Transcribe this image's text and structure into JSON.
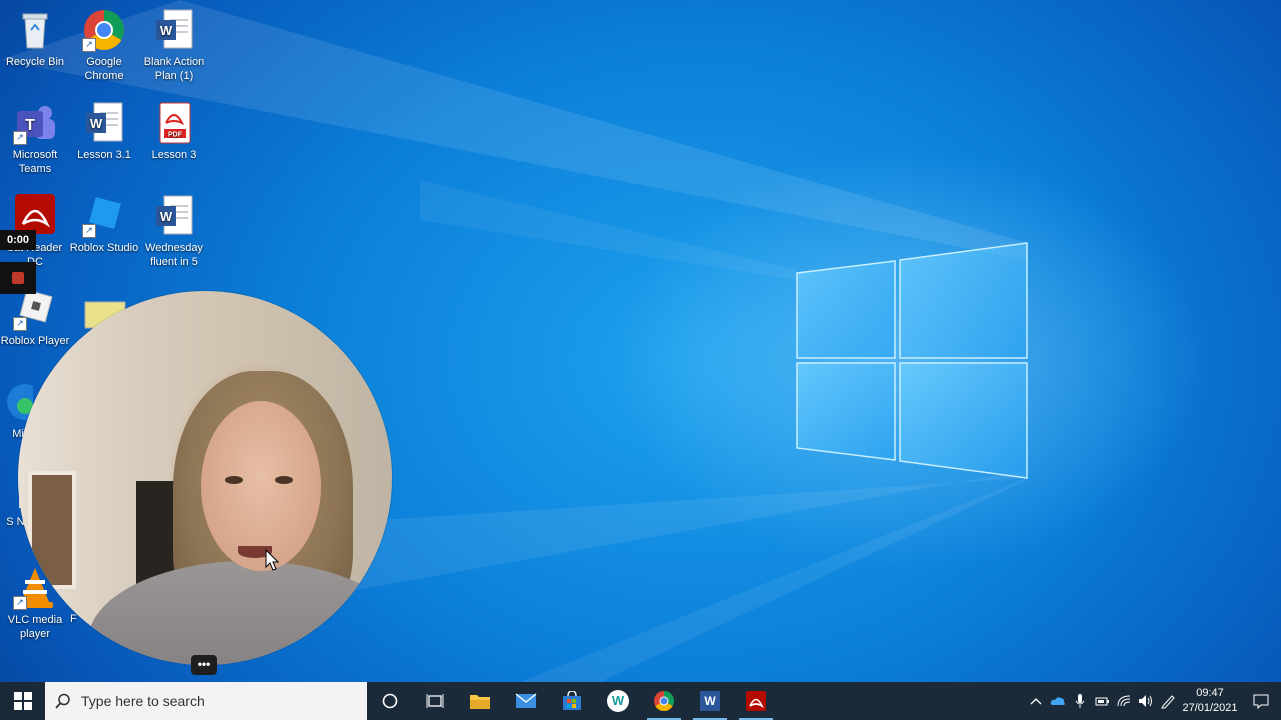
{
  "desktop": {
    "icons": [
      {
        "label": "Recycle Bin",
        "icon": "recycle-bin-icon"
      },
      {
        "label": "Google Chrome",
        "icon": "chrome-icon"
      },
      {
        "label": "Blank Action Plan (1)",
        "icon": "word-document-icon"
      },
      {
        "label": "Microsoft Teams",
        "icon": "teams-icon"
      },
      {
        "label": "Lesson 3.1",
        "icon": "word-document-icon"
      },
      {
        "label": "Lesson 3",
        "icon": "pdf-document-icon"
      },
      {
        "label": "bat Reader DC",
        "icon": "acrobat-icon"
      },
      {
        "label": "Roblox Studio",
        "icon": "roblox-studio-icon"
      },
      {
        "label": "Wednesday fluent in 5",
        "icon": "word-document-icon"
      },
      {
        "label": "Roblox Player",
        "icon": "roblox-player-icon"
      },
      {
        "label": "Mi",
        "icon": "edge-icon"
      },
      {
        "label": "S Not",
        "icon": "sticky-notes-icon"
      },
      {
        "label": "VLC media player",
        "icon": "vlc-icon"
      },
      {
        "label": "S",
        "icon": "app-icon"
      },
      {
        "label": "F",
        "icon": "app-icon"
      }
    ]
  },
  "recorder": {
    "timer": "0:00",
    "menu_label": "•••"
  },
  "taskbar": {
    "search_placeholder": "Type here to search",
    "pinned": [
      "start-icon",
      "cortana-icon",
      "task-view-icon",
      "file-explorer-icon",
      "mail-icon",
      "store-icon",
      "app-w-icon",
      "chrome-icon",
      "word-icon",
      "acrobat-icon"
    ],
    "app_w_label": "W",
    "word_label": "W",
    "time": "09:47",
    "date": "27/01/2021"
  },
  "colors": {
    "taskbar_bg": "#1b2a39",
    "desktop_blue": "#0b7fd9",
    "active_indicator": "#76b9ed"
  }
}
